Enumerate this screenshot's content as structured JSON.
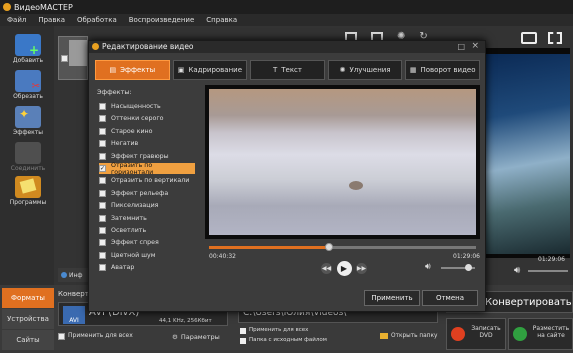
{
  "app": {
    "title": "ВидеоМАСТЕР"
  },
  "menu": [
    "Файл",
    "Правка",
    "Обработка",
    "Воспроизведение",
    "Справка"
  ],
  "toolbar": {
    "add": "Добавить",
    "cut": "Обрезать",
    "effects": "Эффекты",
    "join": "Соединить",
    "programs": "Программы"
  },
  "sidebar_tabs": [
    "Форматы",
    "Устройства",
    "Сайты"
  ],
  "main": {
    "info_tab": "Инф",
    "convert_label": "Конверти",
    "format_name": "AVI (DivX)",
    "format_badge": "AVI",
    "audio_info": "44,1 KHz, 256Кбит",
    "apply_all": "Применить для всех",
    "params_button": "Параметры",
    "path": "C:\\Users\\Юлия\\Videos\\",
    "apply_all_2": "Применить для всех",
    "source_folder": "Папка с исходным файлом",
    "open_folder": "Открыть папку",
    "convert_button": "Конвертировать",
    "burn_dvd": "Записать DVD",
    "publish": "Разместить на сайте",
    "preview_time": "01:29:06",
    "close_icon": "×"
  },
  "dialog": {
    "title": "Редактирование видео",
    "tabs": [
      "Эффекты",
      "Кадрирование",
      "Текст",
      "Улучшения",
      "Поворот видео"
    ],
    "effects_label": "Эффекты:",
    "effects": [
      "Насыщенность",
      "Оттенки серого",
      "Старое кино",
      "Негатив",
      "Эффект гравюры",
      "Отразить по горизонтали",
      "Отразить по вертикали",
      "Эффект рельефа",
      "Пикселизация",
      "Затемнить",
      "Осветлить",
      "Эффект спрея",
      "Цветной шум",
      "Аватар"
    ],
    "selected_effect_index": 5,
    "time_current": "00:40:32",
    "time_total": "01:29:06",
    "progress": 0.45,
    "volume": 0.8,
    "apply_button": "Применить",
    "cancel_button": "Отмена"
  },
  "colors": {
    "accent": "#e07020",
    "selected": "#f0a040"
  }
}
